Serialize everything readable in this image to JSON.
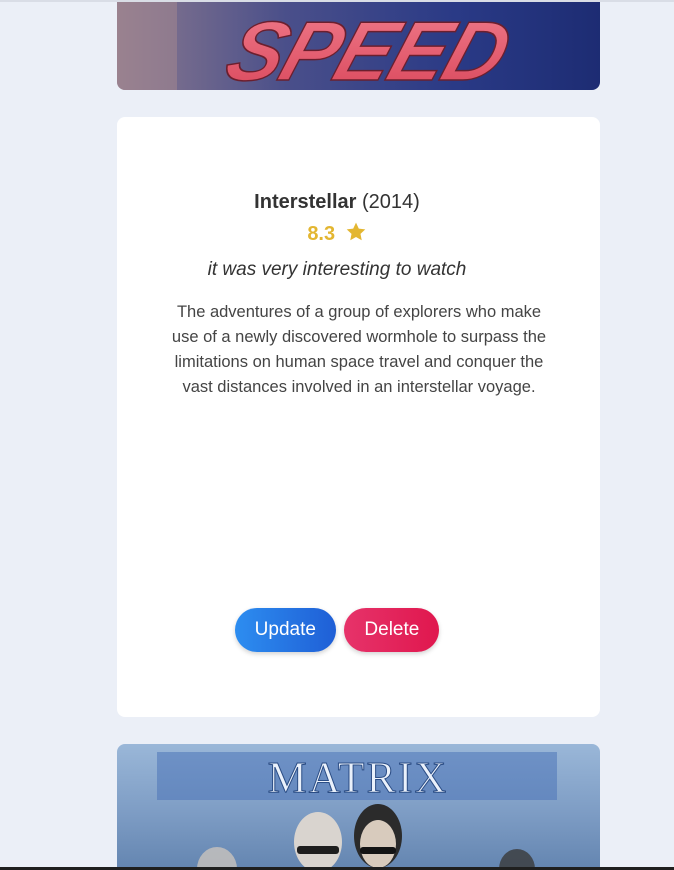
{
  "movies": {
    "previous": {
      "poster_text": "SPEED"
    },
    "current": {
      "title": "Interstellar",
      "year": "(2014)",
      "rating": "8.3",
      "review": "it was very interesting to watch",
      "description": "The adventures of a group of explorers who make use of a newly discovered wormhole to surpass the limitations on human space travel and conquer the vast distances involved in an interstellar voyage.",
      "update_label": "Update",
      "delete_label": "Delete"
    },
    "next": {
      "poster_text": "MATRIX"
    }
  },
  "colors": {
    "page_background": "#ebeff7",
    "card_background": "#ffffff",
    "rating_color": "#e3b631",
    "update_button": "#2d8df0",
    "delete_button": "#e6336a"
  },
  "icons": {
    "rating": "star-icon"
  }
}
